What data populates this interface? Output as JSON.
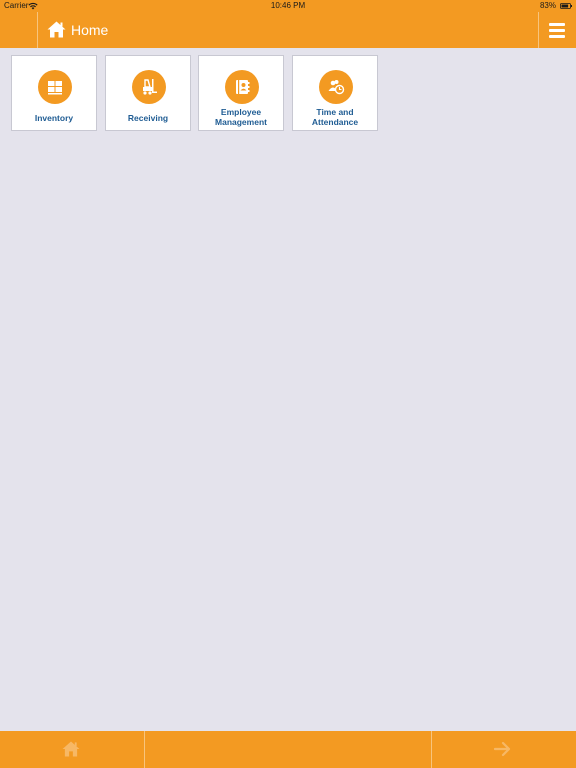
{
  "status_bar": {
    "carrier": "Carrier",
    "time": "10:46 PM",
    "battery": "83%",
    "battery_level": 0.83
  },
  "nav": {
    "title": "Home",
    "home_icon": "home-icon",
    "menu_icon": "hamburger-menu-icon"
  },
  "tiles": [
    {
      "label": "Inventory",
      "icon": "boxes-icon"
    },
    {
      "label": "Receiving",
      "icon": "forklift-icon"
    },
    {
      "label": "Employee Management",
      "icon": "employee-book-icon"
    },
    {
      "label": "Time and Attendance",
      "icon": "people-clock-icon"
    }
  ],
  "toolbar": {
    "home_icon": "home-icon",
    "forward_icon": "arrow-right-icon"
  },
  "colors": {
    "accent": "#f39a22",
    "background": "#e4e3ec",
    "tile_label": "#1f5c93",
    "disabled_icon": "#f7b865"
  }
}
